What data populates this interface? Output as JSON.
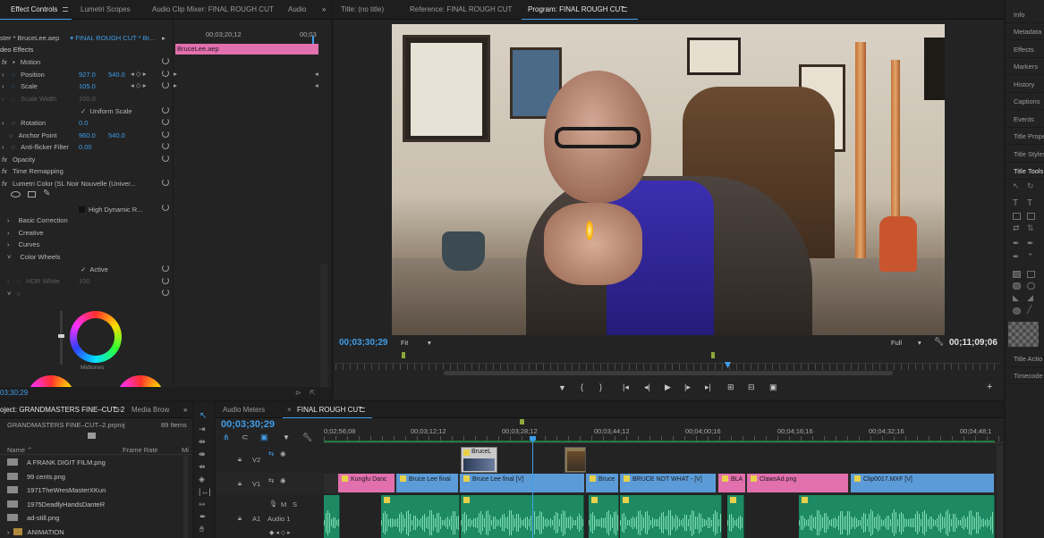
{
  "effect_controls": {
    "tabs": [
      "Effect Controls",
      "Lumetri Scopes",
      "Audio Clip Mixer: FINAL ROUGH CUT",
      "Audio"
    ],
    "menu_icon": "hamburger-icon",
    "overflow_icon": "double-chevron-right-icon",
    "source_label": "ster * BruceLee.aep",
    "sequence_label": "FINAL ROUGH CUT * Br...",
    "section_label": "deo Effects",
    "ruler_time": "00;03;20;12",
    "ruler_time_end": "00;03",
    "clip_bar_label": "BruceLee.aep",
    "rows": {
      "motion": "Motion",
      "position": "Position",
      "position_x": "927.0",
      "position_y": "540.0",
      "scale": "Scale",
      "scale_val": "105.0",
      "scale_width": "Scale Width",
      "scale_width_val": "100.0",
      "uniform_scale": "Uniform Scale",
      "rotation": "Rotation",
      "rotation_val": "0.0",
      "anchor_point": "Anchor Point",
      "anchor_x": "960.0",
      "anchor_y": "540.0",
      "anti_flicker": "Anti-flicker Filter",
      "anti_flicker_val": "0.00",
      "opacity": "Opacity",
      "time_remapping": "Time Remapping",
      "lumetri": "Lumetri Color (SL Noir Nouvelle (Univer...",
      "high_dynamic": "High Dynamic R...",
      "basic_correction": "Basic Correction",
      "creative": "Creative",
      "curves": "Curves",
      "color_wheels": "Color Wheels",
      "active": "Active",
      "hdr_white": "HDR White",
      "hdr_white_val": "100",
      "midtones": "Midtones"
    },
    "bottom_time": "03;30;29"
  },
  "program_monitor": {
    "tabs": [
      "Title: (no title)",
      "Reference: FINAL ROUGH CUT",
      "Program: FINAL ROUGH CUT"
    ],
    "menu_icon": "hamburger-icon",
    "timecode_left": "00;03;30;29",
    "fit_label": "Fit",
    "quality_label": "Full",
    "timecode_right": "00;11;09;06",
    "transport_icons": [
      "marker-icon",
      "mark-in-icon",
      "mark-out-icon",
      "go-to-in-icon",
      "step-back-icon",
      "play-icon",
      "step-forward-icon",
      "go-to-out-icon",
      "lift-icon",
      "extract-icon",
      "camera-icon",
      "add-icon"
    ]
  },
  "right_panel": {
    "items": [
      "Info",
      "Metadata",
      "Effects",
      "Markers",
      "History",
      "Captions",
      "Events",
      "Title Prope",
      "Title Styles",
      "Title Tools",
      "Title Actio",
      "Timecode"
    ]
  },
  "project": {
    "tabs": [
      "oject: GRANDMASTERS FINE–CUT–2",
      "Media Brow"
    ],
    "menu_icon": "hamburger-icon",
    "file_name": "GRANDMASTERS FINE–CUT–2.prproj",
    "item_count": "89 Items",
    "col_name": "Name",
    "col_rate": "Frame Rate",
    "col_media": "Mi",
    "items": [
      "A FRANK DIGIT FILM.png",
      "99 cents.png",
      "1971TheWresMasterXKun",
      "1975DeadlyHandsDanteR",
      "ad-still.png",
      "ANIMATION"
    ]
  },
  "timeline": {
    "tabs": [
      "Audio Meters",
      "FINAL ROUGH CUT"
    ],
    "menu_icon": "hamburger-icon",
    "close_icon": "close-icon",
    "timecode": "00;03;30;29",
    "ruler": [
      "0;02;56;08",
      "00;03;12;12",
      "00;03;28;12",
      "00;03;44;12",
      "00;04;00;16",
      "00;04;16;16",
      "00;04;32;16",
      "00;04;48;1"
    ],
    "tracks": {
      "v2": "V2",
      "v1": "V1",
      "a1": "A1",
      "a1_name": "Audio 1",
      "m": "M",
      "s": "S"
    },
    "video_clips": [
      {
        "label": "Kungfu Danc",
        "color": "#e26fae"
      },
      {
        "label": "Bruce Lee final",
        "color": "#5b9bd8"
      },
      {
        "label": "Bruce Lee final [V]",
        "color": "#5b9bd8"
      },
      {
        "label": "Bruce",
        "color": "#5b9bd8"
      },
      {
        "label": "BRUCE NOT WHAT - [V]",
        "color": "#5b9bd8"
      },
      {
        "label": "BLA",
        "color": "#e26fae"
      },
      {
        "label": "ClawsAd.png",
        "color": "#e26fae"
      },
      {
        "label": "Clip0017.MXF [V]",
        "color": "#5b9bd8"
      }
    ],
    "v2_clip_label": "BruceL"
  }
}
